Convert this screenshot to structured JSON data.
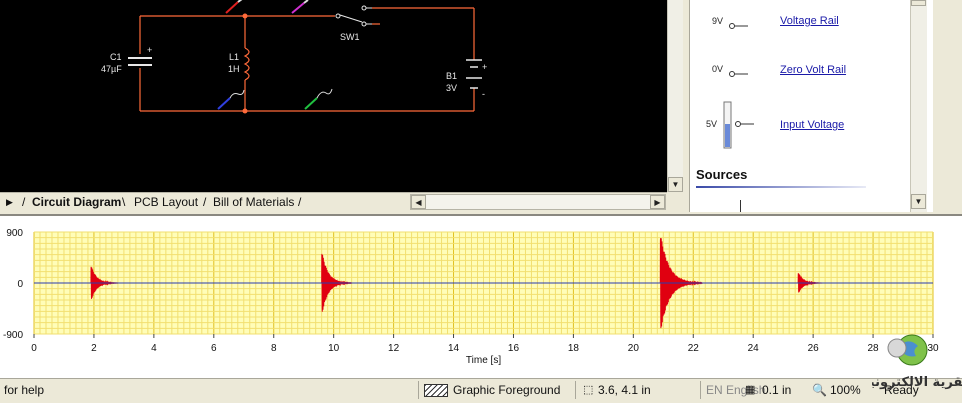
{
  "circuit": {
    "sw1": "SW1",
    "c1_name": "C1",
    "c1_value": "47µF",
    "c1_plus": "+",
    "l1_name": "L1",
    "l1_value": "1H",
    "b1_name": "B1",
    "b1_value": "3V",
    "b1_plus": "+",
    "b1_minus": "-"
  },
  "tabs": [
    "Circuit Diagram",
    "PCB Layout",
    "Bill of Materials"
  ],
  "panel": {
    "items": [
      {
        "level": "9V",
        "link": "Voltage Rail"
      },
      {
        "level": "0V",
        "link": "Zero Volt Rail"
      },
      {
        "level": "5V",
        "link": "Input Voltage"
      }
    ],
    "sources_heading": "Sources"
  },
  "chart_data": {
    "type": "line",
    "title": "",
    "xlabel": "Time [s]",
    "ylabel": "",
    "xlim": [
      0,
      30
    ],
    "ylim": [
      -900,
      900
    ],
    "x_ticks": [
      0,
      2,
      4,
      6,
      8,
      10,
      12,
      14,
      16,
      18,
      20,
      22,
      24,
      26,
      28,
      30
    ],
    "y_tick_labels": [
      "900",
      "0",
      "-900"
    ],
    "grid": true,
    "series_color": "#e00010",
    "bursts": [
      {
        "start": 1.9,
        "amplitude": 330,
        "decay": 0.9
      },
      {
        "start": 9.6,
        "amplitude": 590,
        "decay": 1.0
      },
      {
        "start": 20.9,
        "amplitude": 900,
        "decay": 1.4
      },
      {
        "start": 25.5,
        "amplitude": 200,
        "decay": 0.8
      }
    ]
  },
  "status": {
    "help": "for help",
    "mode": "Graphic Foreground",
    "coords": "3.6, 4.1 in",
    "lang": "EN English",
    "grid": "0.1 in",
    "zoom": "100%",
    "ready": "Ready"
  },
  "watermark": "القرية الالكترونية"
}
